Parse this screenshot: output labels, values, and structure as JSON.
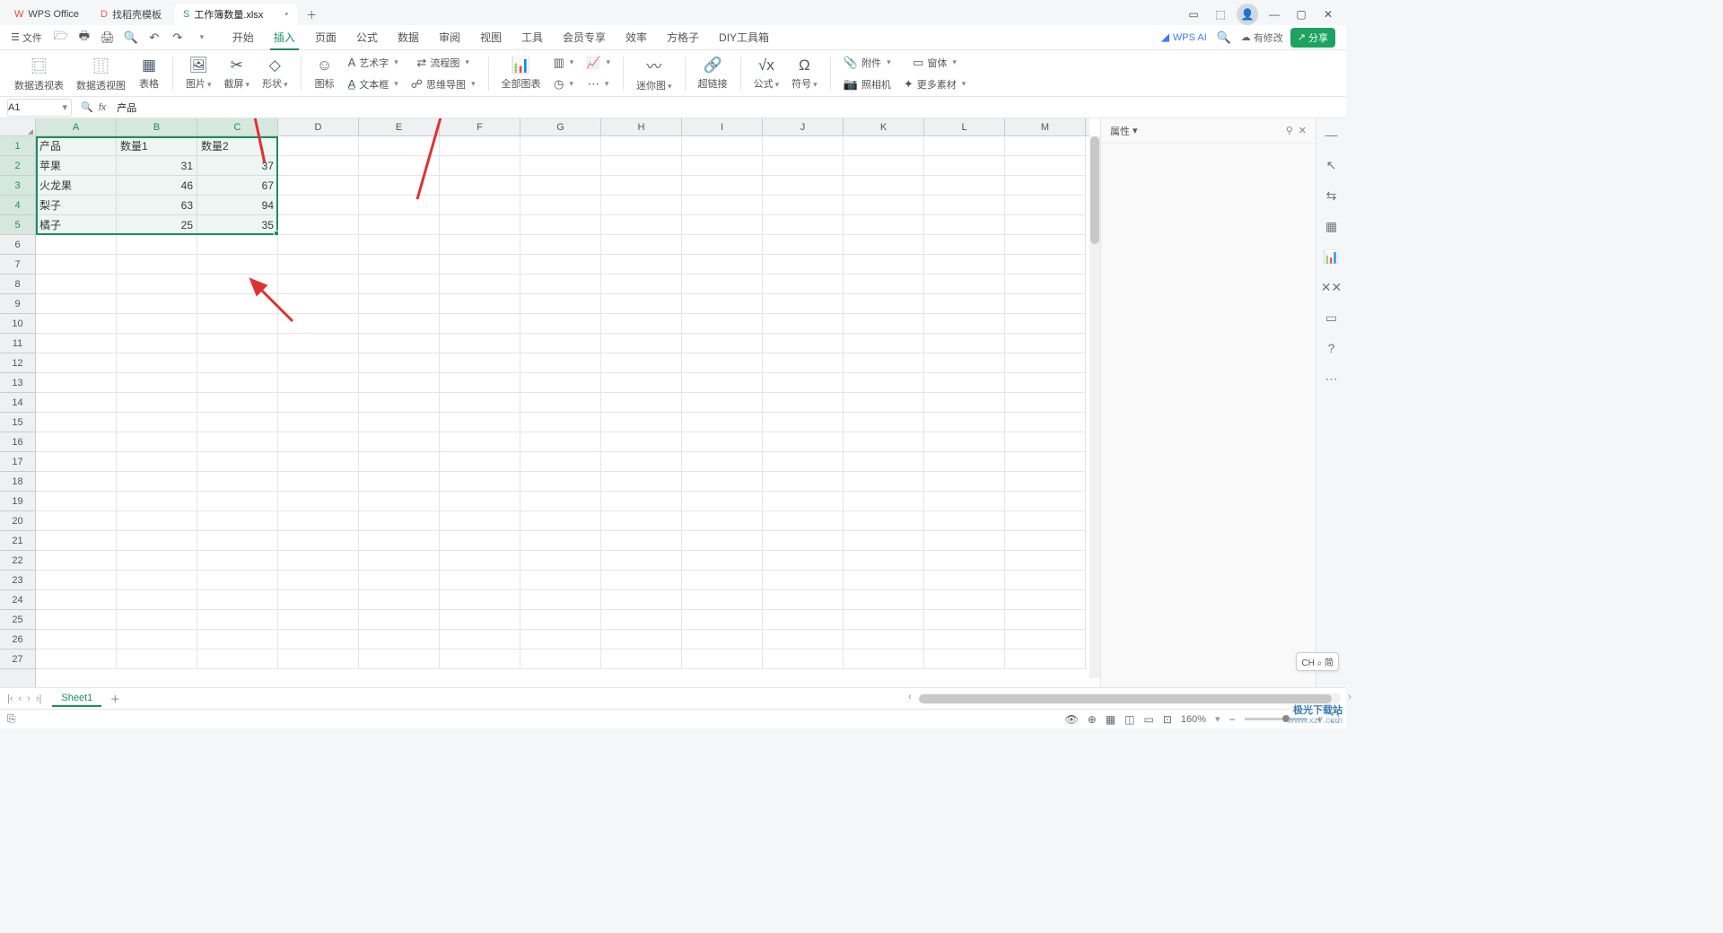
{
  "titlebar": {
    "tabs": [
      {
        "icon": "W",
        "iconColor": "#d64b2f",
        "label": "WPS Office"
      },
      {
        "icon": "D",
        "iconColor": "#e85c5c",
        "label": "找稻壳模板"
      },
      {
        "icon": "S",
        "iconColor": "#1fa463",
        "label": "工作簿数量.xlsx",
        "active": true,
        "dirty": "•"
      }
    ],
    "controls": {
      "pin": "▢",
      "cube": "⬡",
      "avatar": "👤",
      "min": "—",
      "max": "▢",
      "close": "✕"
    }
  },
  "menubar": {
    "fileLabel": "文件",
    "tabs": [
      "开始",
      "插入",
      "页面",
      "公式",
      "数据",
      "审阅",
      "视图",
      "工具",
      "会员专享",
      "效率",
      "方格子",
      "DIY工具箱"
    ],
    "activeTab": 1,
    "wpsAI": "WPS AI",
    "modifyTag": "有修改",
    "shareLabel": "分享"
  },
  "ribbon": {
    "groups": {
      "pivot1": "数据透视表",
      "pivot2": "数据透视图",
      "table": "表格",
      "picture": "图片",
      "screenshot": "截屏",
      "shapes": "形状",
      "icons": "图标",
      "artText": "艺术字",
      "textBox": "文本框",
      "flowchart": "流程图",
      "mindmap": "思维导图",
      "allCharts": "全部图表",
      "sparkline": "迷你图",
      "hyperlink": "超链接",
      "formula": "公式",
      "symbol": "符号",
      "attachment": "附件",
      "camera": "照相机",
      "window": "窗体",
      "moreMaterial": "更多素材"
    }
  },
  "formulaBar": {
    "cellRef": "A1",
    "fxValue": "产品"
  },
  "grid": {
    "columns": [
      "A",
      "B",
      "C",
      "D",
      "E",
      "F",
      "G",
      "H",
      "I",
      "J",
      "K",
      "L",
      "M"
    ],
    "selectedCols": 3,
    "selectedRows": 5,
    "data": [
      [
        "产品",
        "数量1",
        "数量2"
      ],
      [
        "苹果",
        "31",
        "37"
      ],
      [
        "火龙果",
        "46",
        "67"
      ],
      [
        "梨子",
        "63",
        "94"
      ],
      [
        "橘子",
        "25",
        "35"
      ]
    ],
    "totalRows": 27
  },
  "chart_data": {
    "type": "table",
    "headers": [
      "产品",
      "数量1",
      "数量2"
    ],
    "rows": [
      {
        "产品": "苹果",
        "数量1": 31,
        "数量2": 37
      },
      {
        "产品": "火龙果",
        "数量1": 46,
        "数量2": 67
      },
      {
        "产品": "梨子",
        "数量1": 63,
        "数量2": 94
      },
      {
        "产品": "橘子",
        "数量1": 25,
        "数量2": 35
      }
    ]
  },
  "rightPanel": {
    "title": "属性"
  },
  "sheetbar": {
    "sheetName": "Sheet1"
  },
  "statusbar": {
    "zoom": "160%"
  },
  "ime": "CH ⌕ 简",
  "watermark": {
    "line1": "极光下载站",
    "line2": "www.xz7.com"
  }
}
